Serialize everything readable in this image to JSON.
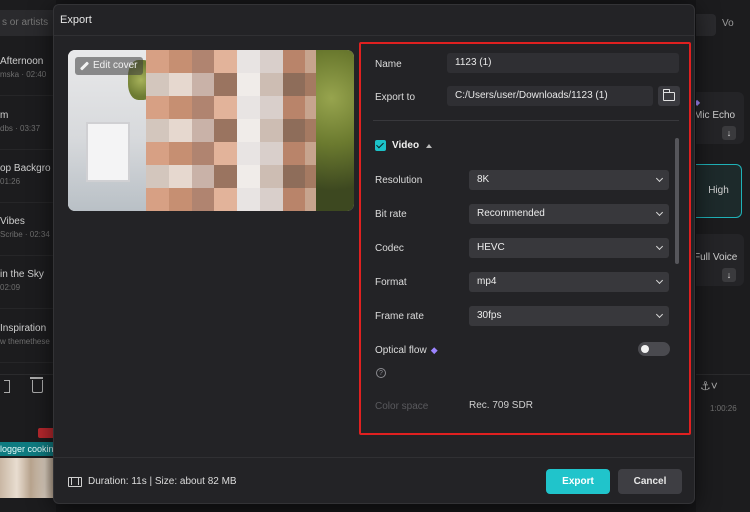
{
  "background": {
    "search_placeholder": "s or artists",
    "tracks": [
      {
        "title": "Afternoon",
        "sub": "mska · 02:40"
      },
      {
        "title": "m",
        "sub": "dbs · 03:37"
      },
      {
        "title": "op Backgro",
        "sub": "01:26"
      },
      {
        "title": "Vibes",
        "sub": "Scribe · 02:34"
      },
      {
        "title": " in the Sky",
        "sub": "02:09"
      },
      {
        "title": "Inspiration",
        "sub": "w themethese"
      }
    ],
    "clip_label": "logger cookin",
    "right_top": "Vo",
    "right_cards": [
      "Mic Echo",
      "Full Voice"
    ],
    "right_selected": "High",
    "right_time": "1:00:26"
  },
  "dialog": {
    "title": "Export",
    "edit_cover_label": "Edit cover",
    "name_label": "Name",
    "name_value": "1123 (1)",
    "export_to_label": "Export to",
    "export_to_value": "C:/Users/user/Downloads/1123 (1)",
    "video_label": "Video",
    "video_checked": true,
    "resolution": {
      "label": "Resolution",
      "value": "8K"
    },
    "bit_rate": {
      "label": "Bit rate",
      "value": "Recommended"
    },
    "codec": {
      "label": "Codec",
      "value": "HEVC"
    },
    "format": {
      "label": "Format",
      "value": "mp4"
    },
    "frame_rate": {
      "label": "Frame rate",
      "value": "30fps"
    },
    "optical_flow": {
      "label": "Optical flow",
      "enabled": false
    },
    "color_space": {
      "label": "Color space",
      "value": "Rec. 709 SDR"
    },
    "footer_info": "Duration: 11s | Size: about 82 MB",
    "export_button": "Export",
    "cancel_button": "Cancel"
  },
  "colors": {
    "accent": "#20c4cb",
    "highlight_box": "#e02020",
    "premium_gem": "#9c84ff"
  }
}
